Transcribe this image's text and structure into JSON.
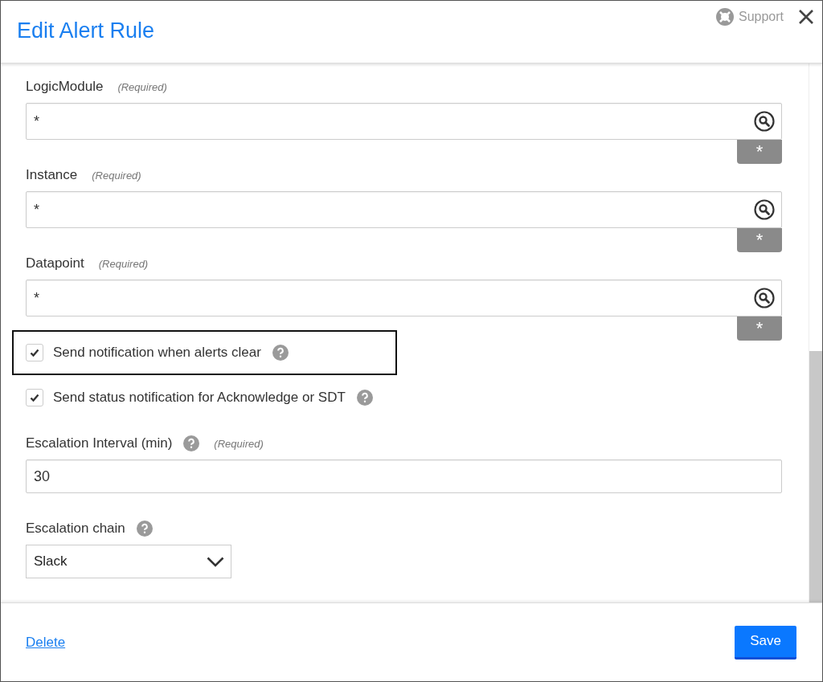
{
  "window": {
    "title": "Edit Alert Rule",
    "support": "Support"
  },
  "fields": [
    {
      "kind": "lookup",
      "label": "LogicModule",
      "note": "(Required)",
      "value": "*",
      "tag": "*"
    },
    {
      "kind": "lookup",
      "label": "Instance",
      "note": "(Required)",
      "value": "*",
      "tag": "*"
    },
    {
      "kind": "lookup",
      "label": "Datapoint",
      "note": "(Required)",
      "value": "*",
      "tag": "*"
    },
    {
      "kind": "checkbox",
      "label": "Send notification when alerts clear",
      "checked": true,
      "help": true,
      "highlighted": true
    },
    {
      "kind": "checkbox",
      "label": "Send status notification for Acknowledge or SDT",
      "checked": true,
      "help": true,
      "highlighted": false
    },
    {
      "kind": "text",
      "label": "Escalation Interval (min)",
      "help": true,
      "note": "(Required)",
      "value": "30"
    },
    {
      "kind": "select",
      "label": "Escalation chain",
      "help": true,
      "value": "Slack"
    }
  ],
  "footer": {
    "delete": "Delete",
    "save": "Save"
  }
}
